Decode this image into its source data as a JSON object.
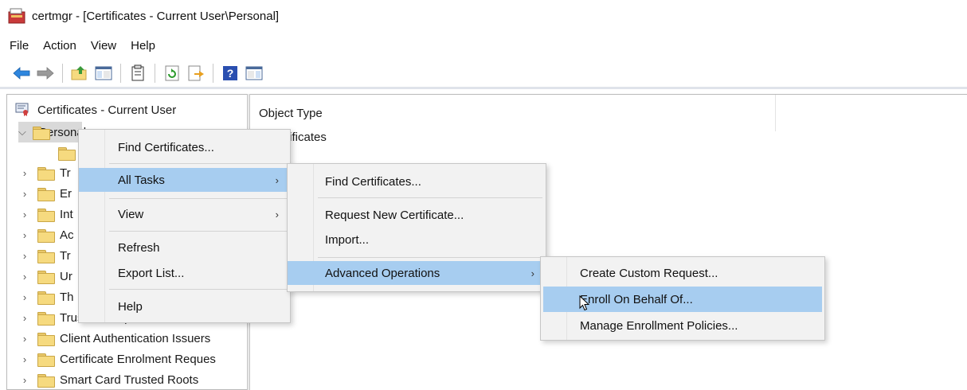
{
  "window": {
    "title": "certmgr - [Certificates - Current User\\Personal]"
  },
  "menubar": [
    "File",
    "Action",
    "View",
    "Help"
  ],
  "toolbar": {
    "buttons": [
      "back-icon",
      "forward-icon",
      "up-folder-icon",
      "show-hide-console-tree-icon",
      "properties-icon",
      "refresh-icon",
      "export-list-icon",
      "help-icon",
      "show-action-pane-icon"
    ]
  },
  "tree": {
    "root": "Certificates - Current User",
    "personal": "Personal",
    "items": [
      "Tr",
      "Er",
      "Int",
      "Ac",
      "Tr",
      "Ur",
      "Th",
      "Trusted People",
      "Client Authentication Issuers",
      "Certificate Enrolment Reques",
      "Smart Card Trusted Roots"
    ]
  },
  "list": {
    "column_header": "Object Type",
    "rows": [
      "rtificates"
    ]
  },
  "context_menu": {
    "items": [
      {
        "label": "Find Certificates...",
        "submenu": false
      },
      {
        "label": "All Tasks",
        "submenu": true,
        "highlighted": true
      },
      {
        "label": "View",
        "submenu": true
      },
      {
        "label": "Refresh",
        "submenu": false
      },
      {
        "label": "Export List...",
        "submenu": false
      },
      {
        "label": "Help",
        "submenu": false
      }
    ]
  },
  "all_tasks_menu": {
    "items": [
      {
        "label": "Find Certificates...",
        "submenu": false
      },
      {
        "label": "Request New Certificate...",
        "submenu": false
      },
      {
        "label": "Import...",
        "submenu": false
      },
      {
        "label": "Advanced Operations",
        "submenu": true,
        "highlighted": true
      }
    ]
  },
  "advanced_menu": {
    "items": [
      {
        "label": "Create Custom Request...",
        "highlighted": false
      },
      {
        "label": "Enroll On Behalf Of...",
        "highlighted": true
      },
      {
        "label": "Manage Enrollment Policies...",
        "highlighted": false
      }
    ]
  },
  "colors": {
    "menu_highlight": "#a7cdf0",
    "menu_background": "#f2f2f2",
    "folder": "#f6da7f"
  }
}
